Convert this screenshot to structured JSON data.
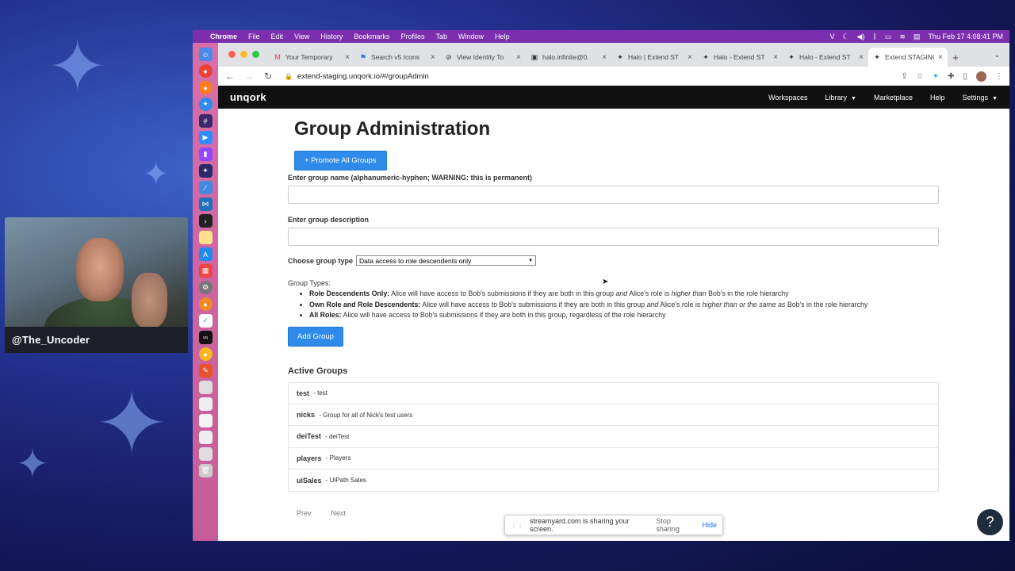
{
  "webcam": {
    "label": "@The_Uncoder"
  },
  "menubar": {
    "app": "Chrome",
    "items": [
      "File",
      "Edit",
      "View",
      "History",
      "Bookmarks",
      "Profiles",
      "Tab",
      "Window",
      "Help"
    ],
    "datetime": "Thu Feb 17  4:08:41 PM"
  },
  "tabs": [
    {
      "label": "Your Temporary",
      "icon": "gmail-icon"
    },
    {
      "label": "Search v5 Icons",
      "icon": "flag-icon"
    },
    {
      "label": "View Identity To",
      "icon": "identity-icon"
    },
    {
      "label": "halo.infinite@0.",
      "icon": "page-icon"
    },
    {
      "label": "Halo | Extend ST",
      "icon": "star-icon"
    },
    {
      "label": "Halo - Extend ST",
      "icon": "star-icon"
    },
    {
      "label": "Halo - Extend ST",
      "icon": "star-icon"
    },
    {
      "label": "Extend STAGING",
      "icon": "star-icon",
      "active": true
    }
  ],
  "url": "extend-staging.unqork.io/#/groupAdmin",
  "navbar": {
    "logo": "unqork",
    "links": [
      {
        "label": "Workspaces",
        "caret": false
      },
      {
        "label": "Library",
        "caret": true
      },
      {
        "label": "Marketplace",
        "caret": false
      },
      {
        "label": "Help",
        "caret": false
      },
      {
        "label": "Settings",
        "caret": true
      }
    ]
  },
  "main": {
    "title": "Group Administration",
    "promote_label": "+ Promote All Groups",
    "name_label": "Enter group name (alphanumeric-hyphen; WARNING: this is permanent)",
    "name_value": "",
    "desc_label": "Enter group description",
    "desc_value": "",
    "type_label": "Choose group type",
    "type_value": "Data access to role descendents only",
    "types_heading": "Group Types:",
    "types": [
      {
        "name": "Role Descendents Only:",
        "text_a": " Alice will have access to Bob's submissions if they are both in this group ",
        "em1": "and",
        "text_b": " Alice's role is ",
        "em2": "higher than",
        "text_c": " Bob's in the role hierarchy"
      },
      {
        "name": "Own Role and Role Descendents:",
        "text_a": " Alice will have access to Bob's submissions if they are both in this group ",
        "em1": "and",
        "text_b": " Alice's role is ",
        "em2": "higher than or the same as",
        "text_c": " Bob's in the role hierarchy"
      },
      {
        "name": "All Roles:",
        "text_a": " Alice will have access to Bob's submissions if they are both in this group, regardless of the role hierarchy",
        "em1": "",
        "text_b": "",
        "em2": "",
        "text_c": ""
      }
    ],
    "add_label": "Add Group",
    "active_heading": "Active Groups",
    "groups": [
      {
        "name": "test",
        "desc": "test"
      },
      {
        "name": "nicks",
        "desc": "Group for all of Nick's test users"
      },
      {
        "name": "deiTest",
        "desc": "deiTest"
      },
      {
        "name": "players",
        "desc": "Players"
      },
      {
        "name": "uiSales",
        "desc": "UiPath Sales"
      }
    ],
    "prev_label": "Prev",
    "next_label": "Next"
  },
  "share_bar": {
    "message": "streamyard.com is sharing your screen.",
    "stop_label": "Stop sharing",
    "hide_label": "Hide"
  },
  "help_fab": "?",
  "colors": {
    "primary": "#2f8bea",
    "navbar": "#111111",
    "menubar": "#7b2fae",
    "dock": "#d86fa8"
  }
}
